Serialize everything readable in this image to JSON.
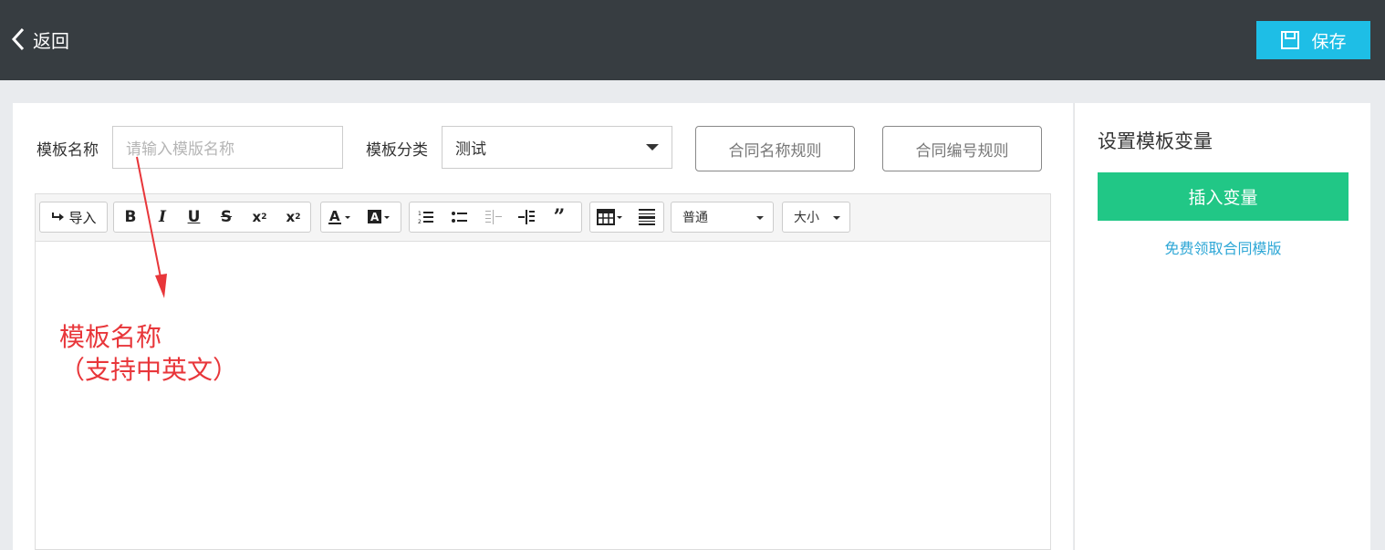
{
  "header": {
    "back_label": "返回",
    "save_label": "保存"
  },
  "form": {
    "name_label": "模板名称",
    "name_placeholder": "请输入模版名称",
    "category_label": "模板分类",
    "category_value": "测试",
    "name_rule_button": "合同名称规则",
    "number_rule_button": "合同编号规则"
  },
  "toolbar": {
    "import_label": "导入",
    "paragraph_select": "普通",
    "size_select": "大小"
  },
  "annotation": {
    "line1": "模板名称",
    "line2": "（支持中英文）",
    "color": "#e8363a"
  },
  "sidebar": {
    "title": "设置模板变量",
    "insert_button": "插入变量",
    "free_link": "免费领取合同模版"
  },
  "colors": {
    "topbar": "#373d41",
    "save_button": "#1ebee6",
    "insert_button": "#21c786",
    "link": "#2ea7d6"
  }
}
